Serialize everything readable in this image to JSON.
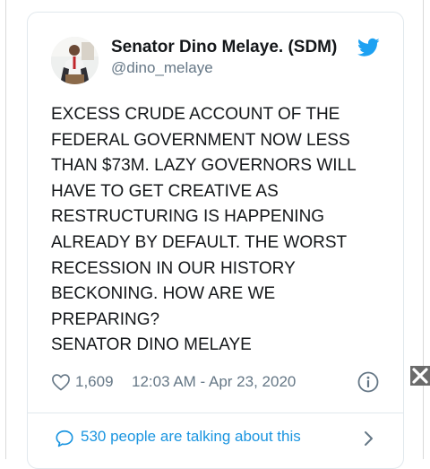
{
  "tweet": {
    "author_name": "Senator Dino Melaye. (SDM)",
    "author_handle": "@dino_melaye",
    "text_lines": [
      "EXCESS CRUDE ACCOUNT OF THE",
      "FEDERAL GOVERNMENT NOW LESS",
      "THAN $73M. LAZY GOVERNORS WILL",
      "HAVE TO GET CREATIVE AS",
      "RESTRUCTURING IS HAPPENING",
      "ALREADY BY DEFAULT.  THE WORST",
      "RECESSION IN OUR HISTORY",
      "BECKONING. HOW ARE WE",
      "PREPARING?",
      "SENATOR DINO MELAYE"
    ],
    "like_count": "1,609",
    "timestamp": "12:03 AM - Apr 23, 2020",
    "conversation_text": "530 people are talking about this"
  },
  "icons": {
    "brand": "twitter-bird-icon",
    "like": "heart-icon",
    "info": "info-icon",
    "conversation": "chat-bubble-icon",
    "more": "chevron-right-icon",
    "close": "close-icon"
  },
  "colors": {
    "twitter_blue": "#1da1f2",
    "link_blue": "#1b95e0",
    "secondary_text": "#657786",
    "primary_text": "#14171a",
    "border": "#e1e8ed"
  }
}
